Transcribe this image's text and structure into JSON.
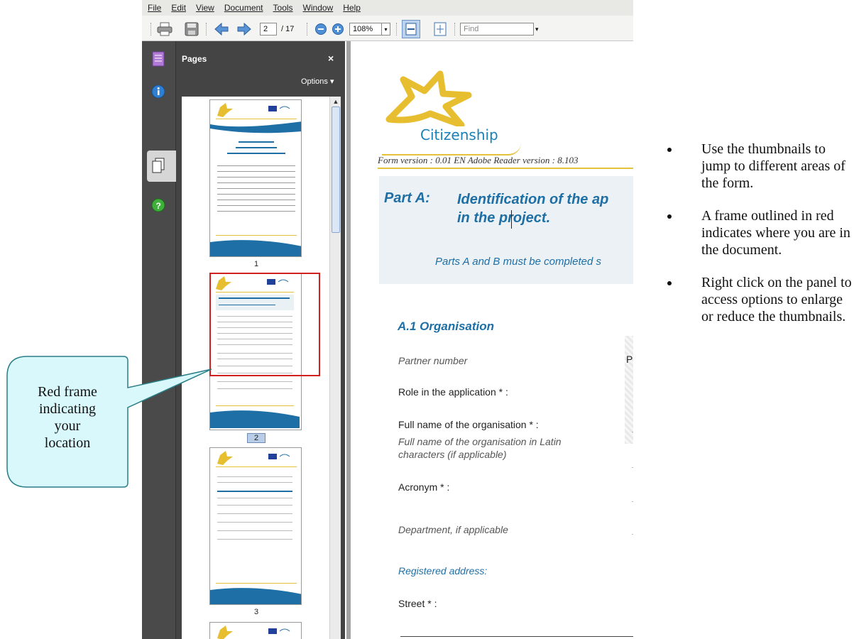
{
  "menu": [
    "File",
    "Edit",
    "View",
    "Document",
    "Tools",
    "Window",
    "Help"
  ],
  "toolbar": {
    "page_current": "2",
    "page_total": "/ 17",
    "zoom": "108%",
    "find_placeholder": "Find"
  },
  "pages_panel": {
    "title": "Pages",
    "close": "×",
    "options": "Options ▾",
    "thumbnails": [
      {
        "label": "1",
        "current": false
      },
      {
        "label": "2",
        "current": true
      },
      {
        "label": "3",
        "current": false
      }
    ]
  },
  "document": {
    "logo_text": "Citizenship",
    "form_version": "Form version : 0.01 EN  Adobe Reader version : 8.103",
    "part_label": "Part A:",
    "part_title_1": "Identification of the ap",
    "part_title_2": "in the project.",
    "parts_note": "Parts A and B must be completed s",
    "section_title": "A.1 Organisation",
    "partner_number": "Partner number",
    "partner_number_fragment": "P",
    "role": "Role in the application * :",
    "full_name": "Full name of the organisation * :",
    "full_name_latin_1": "Full name of the organisation in Latin",
    "full_name_latin_2": "characters (if applicable)",
    "acronym": "Acronym * :",
    "department": "Department, if applicable",
    "registered_address": "Registered address:",
    "street": "Street * :"
  },
  "callout": {
    "line1": "Red frame",
    "line2": "indicating",
    "line3": "your",
    "line4": "location"
  },
  "notes": [
    "Use the thumbnails to jump to different areas of the form.",
    "A frame outlined in red indicates where you are in the document.",
    "Right click on the panel to access options to enlarge or reduce the thumbnails."
  ],
  "colors": {
    "accent_blue": "#1e6fa6",
    "current_frame": "#d02020",
    "callout_fill": "#d8f8fb",
    "callout_border": "#2a7d86",
    "panel_dark": "#444444"
  }
}
